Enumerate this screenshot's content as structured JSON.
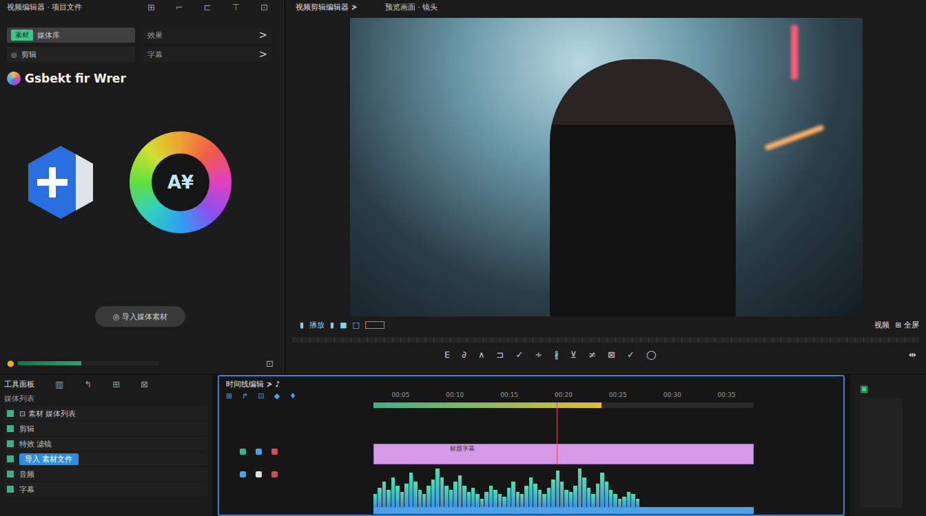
{
  "app": {
    "title": "视频编辑器 · 项目文件",
    "top_icons": [
      "⊞",
      "⌐",
      "⊏",
      "⊤",
      "⊡"
    ]
  },
  "left_panel": {
    "rows": [
      {
        "tag": "素材",
        "text": "媒体库",
        "selected": true,
        "link": "效果",
        "arrow": ">"
      },
      {
        "tag": "◎",
        "text": "剪辑",
        "selected": false,
        "link": "字幕",
        "arrow": ">"
      }
    ],
    "brand": "Gsbekt fir Wrer",
    "tool_badge": "A¥",
    "pill": "◎ 导入媒体素材",
    "status": {
      "dot": "●",
      "level": 0.45,
      "icon": "⊡"
    }
  },
  "preview": {
    "title": "视频剪辑编辑器 ≯",
    "subtitle": "预览画面 · 镜头",
    "transport": [
      "▮",
      "播放",
      "▮",
      "■",
      "□"
    ],
    "transport_right": [
      "视频",
      "⊞ 全屏"
    ],
    "tools": [
      "E",
      "∂",
      "∧",
      "⊐",
      "✓",
      "∻",
      "∦",
      "⊻",
      "≠",
      "⊠",
      "✓",
      "◯"
    ],
    "tool_right": "⇹"
  },
  "bottom_left": {
    "title": "工具面板",
    "title_icons": [
      "▥",
      "↰",
      "⊞",
      "⊠"
    ],
    "subtitle": "媒体列表",
    "items": [
      {
        "label": "⊡ 素材 媒体列表",
        "selected": false
      },
      {
        "label": "剪辑",
        "selected": false
      },
      {
        "label": "特效 滤镜",
        "selected": false
      },
      {
        "label": "导入 素材文件",
        "selected": true
      },
      {
        "label": "音频",
        "selected": false
      },
      {
        "label": "字幕",
        "selected": false
      }
    ]
  },
  "timeline": {
    "title": "时间线编辑 ≯ ♪",
    "track_icons": [
      "⊞",
      "↱",
      "⊡",
      "◆",
      "♦"
    ],
    "ruler": [
      "00:05",
      "00:10",
      "00:15",
      "00:20",
      "00:25",
      "00:30",
      "00:35"
    ],
    "playhead": 0.39,
    "clip": {
      "label": "标题字幕",
      "start": 0.0,
      "end": 0.8
    },
    "waveform": [
      0.3,
      0.45,
      0.6,
      0.4,
      0.7,
      0.5,
      0.35,
      0.55,
      0.8,
      0.6,
      0.4,
      0.3,
      0.5,
      0.65,
      0.9,
      0.7,
      0.5,
      0.4,
      0.6,
      0.75,
      0.5,
      0.35,
      0.45,
      0.3,
      0.2,
      0.35,
      0.5,
      0.4,
      0.3,
      0.25,
      0.45,
      0.6,
      0.35,
      0.3,
      0.5,
      0.7,
      0.55,
      0.4,
      0.3,
      0.45,
      0.65,
      0.85,
      0.6,
      0.4,
      0.35,
      0.5,
      0.9,
      0.7,
      0.45,
      0.3,
      0.55,
      0.8,
      0.6,
      0.4,
      0.3,
      0.2,
      0.25,
      0.35,
      0.3,
      0.2
    ]
  },
  "meter": {
    "icon": "▣",
    "level": 0.0
  }
}
